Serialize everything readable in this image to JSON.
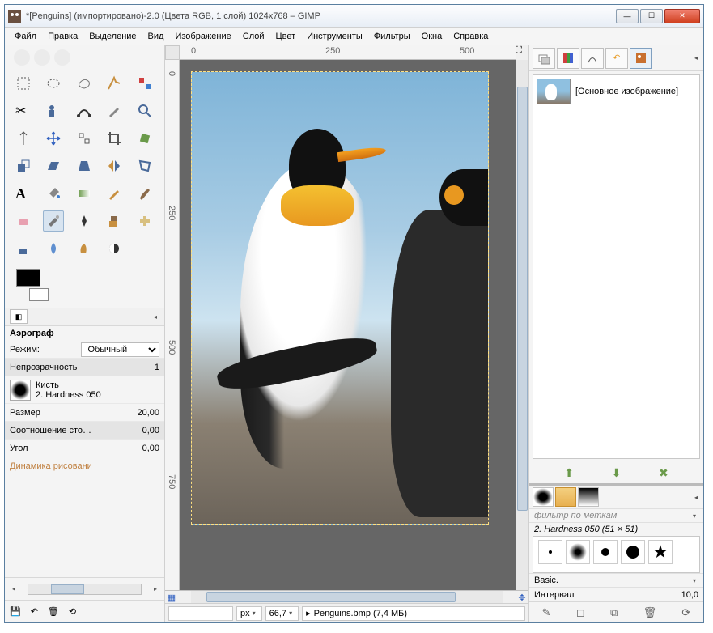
{
  "title": "*[Penguins] (импортировано)-2.0 (Цвета RGB, 1 слой) 1024x768 – GIMP",
  "menu": [
    "Файл",
    "Правка",
    "Выделение",
    "Вид",
    "Изображение",
    "Слой",
    "Цвет",
    "Инструменты",
    "Фильтры",
    "Окна",
    "Справка"
  ],
  "ruler_h": {
    "m0": "0",
    "m250": "250",
    "m500": "500"
  },
  "ruler_v": {
    "m0": "0",
    "m250": "250",
    "m500": "500",
    "m750": "750"
  },
  "tool_options": {
    "title": "Аэрограф",
    "mode_label": "Режим:",
    "mode_value": "Обычный",
    "opacity_label": "Непрозрачность",
    "opacity_value": "1",
    "brush_label": "Кисть",
    "brush_name": "2. Hardness 050",
    "size_label": "Размер",
    "size_value": "20,00",
    "ratio_label": "Соотношение сто…",
    "ratio_value": "0,00",
    "angle_label": "Угол",
    "angle_value": "0,00",
    "dynamics_label": "Динамика рисовани"
  },
  "status": {
    "unit": "px",
    "zoom": "66,7",
    "file": "Penguins.bmp (7,4 МБ)"
  },
  "layers": {
    "item_label": "[Основное изображение]"
  },
  "brushes": {
    "filter_placeholder": "фильтр по меткам",
    "current": "2. Hardness 050 (51 × 51)",
    "category": "Basic.",
    "interval_label": "Интервал",
    "interval_value": "10,0"
  }
}
